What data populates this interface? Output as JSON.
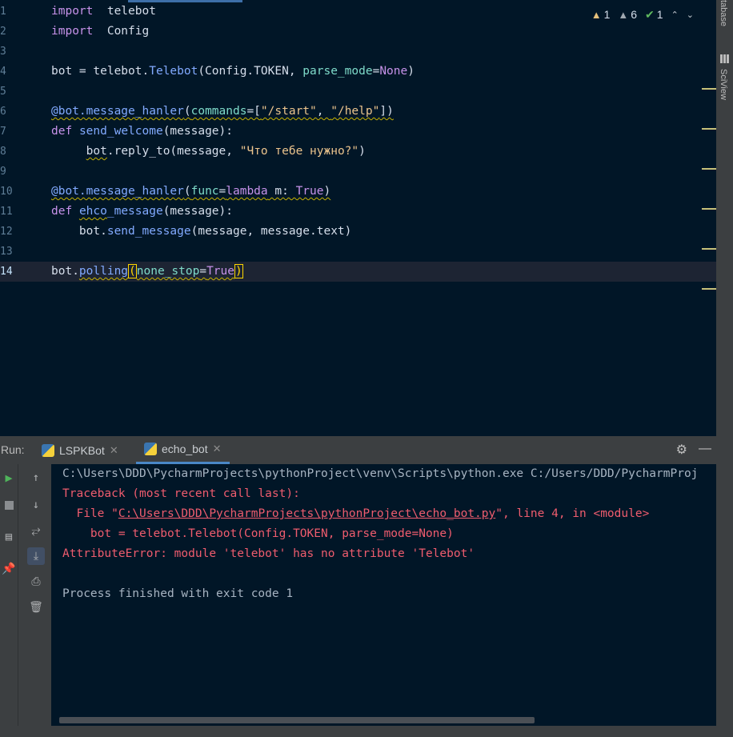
{
  "editor": {
    "lines": [
      {
        "num": "1",
        "parts": [
          [
            "kw",
            "import"
          ],
          [
            "",
            "  telebot"
          ]
        ]
      },
      {
        "num": "2",
        "parts": [
          [
            "kw",
            "import"
          ],
          [
            "",
            "  Config"
          ]
        ]
      },
      {
        "num": "3",
        "parts": []
      },
      {
        "num": "4",
        "parts": [
          [
            "",
            "bot = telebot."
          ],
          [
            "cls",
            "Telebot"
          ],
          [
            "",
            "(Config.TOKEN, "
          ],
          [
            "prm",
            "parse_mode"
          ],
          [
            "",
            "="
          ],
          [
            "kw",
            "None"
          ],
          [
            "",
            ")"
          ]
        ]
      },
      {
        "num": "5",
        "parts": []
      },
      {
        "num": "6",
        "parts": [
          [
            "dec warn",
            "@bot.message_hanler"
          ],
          [
            "warn",
            "("
          ],
          [
            "prm warn",
            "commands"
          ],
          [
            "warn",
            "=["
          ],
          [
            "str warn",
            "\"/start\""
          ],
          [
            "warn",
            ", "
          ],
          [
            "str warn",
            "\"/help\""
          ],
          [
            "warn",
            "])"
          ]
        ]
      },
      {
        "num": "7",
        "parts": [
          [
            "kw",
            "def"
          ],
          [
            "",
            " "
          ],
          [
            "fn",
            "send_welcome"
          ],
          [
            "",
            "(message):"
          ]
        ]
      },
      {
        "num": "8",
        "parts": [
          [
            "",
            "     "
          ],
          [
            "warn",
            "bot"
          ],
          [
            "",
            ".reply_to(message, "
          ],
          [
            "str",
            "\"Что тебе нужно?\""
          ],
          [
            "",
            ")"
          ]
        ]
      },
      {
        "num": "9",
        "parts": []
      },
      {
        "num": "10",
        "parts": [
          [
            "dec warn",
            "@bot.message_hanler"
          ],
          [
            "warn",
            "("
          ],
          [
            "prm warn",
            "func"
          ],
          [
            "warn",
            "="
          ],
          [
            "kw warn",
            "lambda"
          ],
          [
            "warn",
            " m: "
          ],
          [
            "kw warn",
            "True"
          ],
          [
            "warn",
            ")"
          ]
        ]
      },
      {
        "num": "11",
        "parts": [
          [
            "kw",
            "def"
          ],
          [
            "",
            " "
          ],
          [
            "fn warn",
            "ehco"
          ],
          [
            "fn",
            "_message"
          ],
          [
            "",
            "(message):"
          ]
        ]
      },
      {
        "num": "12",
        "parts": [
          [
            "",
            "    bot."
          ],
          [
            "fn",
            "send_message"
          ],
          [
            "",
            "(message, message.text)"
          ]
        ]
      },
      {
        "num": "13",
        "parts": []
      },
      {
        "num": "14",
        "parts": [
          [
            "",
            "bot."
          ],
          [
            "fn warn",
            "polling"
          ],
          [
            "bracket-hl",
            "("
          ],
          [
            "prm warn",
            "none_stop"
          ],
          [
            "warn",
            "="
          ],
          [
            "kw warn",
            "True"
          ],
          [
            "bracket-hl",
            ")"
          ]
        ]
      }
    ]
  },
  "inspections": {
    "warnings": "1",
    "weak_warnings": "6",
    "typos": "1"
  },
  "right_strip": {
    "database": "tabase",
    "sciview": "SciView"
  },
  "run": {
    "label": "Run:",
    "tabs": [
      {
        "label": "LSPKBot"
      },
      {
        "label": "echo_bot"
      }
    ]
  },
  "console": {
    "cmd": "C:\\Users\\DDD\\PycharmProjects\\pythonProject\\venv\\Scripts\\python.exe C:/Users/DDD/PycharmProj",
    "traceback": "Traceback (most recent call last):",
    "file_prefix": "  File \"",
    "file_path": "C:\\Users\\DDD\\PycharmProjects\\pythonProject\\echo_bot.py",
    "file_suffix": "\", line 4, in <module>",
    "code_line": "    bot = telebot.Telebot(Config.TOKEN, parse_mode=None)",
    "error": "AttributeError: module 'telebot' has no attribute 'Telebot'",
    "finished": "Process finished with exit code 1"
  }
}
